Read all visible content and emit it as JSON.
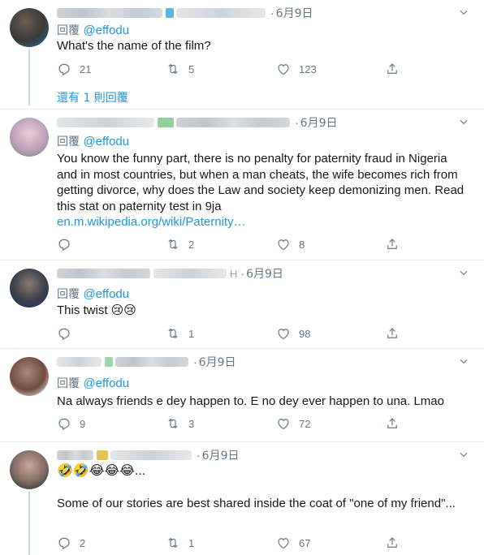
{
  "tweets": [
    {
      "date": "6月9日",
      "reply_label": "回覆",
      "handle": "@effodu",
      "text": "What's the name of the film?",
      "replies": "21",
      "retweets": "5",
      "likes": "123",
      "more_replies": "還有 1 則回覆"
    },
    {
      "date": "6月9日",
      "reply_label": "回覆",
      "handle": "@effodu",
      "text": "You know the funny part, there is no penalty for paternity fraud in Nigeria and in most countries, but when a man cheats, the wife becomes rich from getting divorce, why does the Law and society keep demonizing men. Read this stat on paternity test in 9ja",
      "link": "en.m.wikipedia.org/wiki/Paternity…",
      "replies": "",
      "retweets": "2",
      "likes": "8"
    },
    {
      "date": "6月9日",
      "name_tail": "H",
      "reply_label": "回覆",
      "handle": "@effodu",
      "text": "This twist 😢😢",
      "replies": "",
      "retweets": "1",
      "likes": "98"
    },
    {
      "date": "6月9日",
      "reply_label": "回覆",
      "handle": "@effodu",
      "text": "Na always friends e dey happen to. E no dey ever happen to una. Lmao",
      "replies": "9",
      "retweets": "3",
      "likes": "72"
    },
    {
      "date": "6月9日",
      "text_line1": "🤣🤣😂😂😂...",
      "text": "Some of our stories are best shared inside the coat of \"one of my friend\"...",
      "replies": "2",
      "retweets": "1",
      "likes": "67"
    }
  ],
  "icons": {
    "reply": "reply-icon",
    "retweet": "retweet-icon",
    "like": "heart-icon",
    "share": "share-icon",
    "menu": "chevron-down-icon"
  },
  "colors": {
    "link": "#1b95e0",
    "muted": "#657786",
    "divider": "#e6ecf0"
  }
}
